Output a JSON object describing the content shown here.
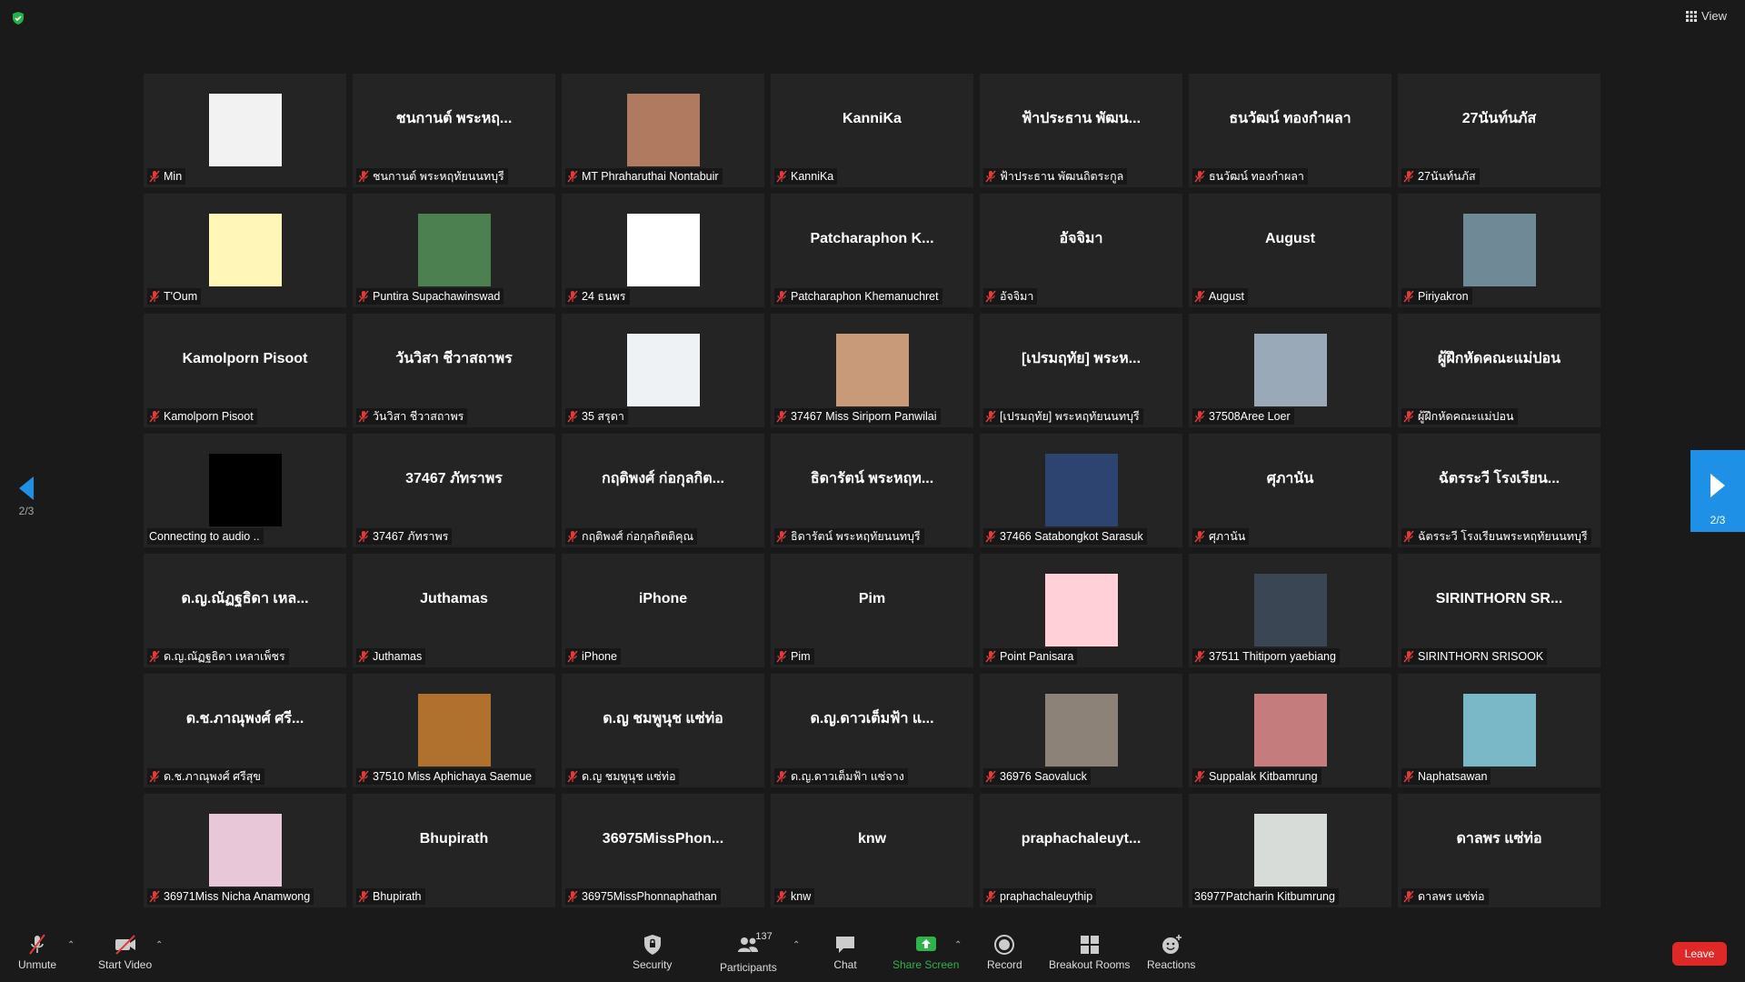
{
  "view_label": "View",
  "tiles": [
    {
      "center": "",
      "label": "Min",
      "avatar": "#f2f2f2",
      "muted": true
    },
    {
      "center": "ชนกานต์ พระหฤ...",
      "label": "ชนกานต์ พระหฤทัยนนทบุรี",
      "muted": true
    },
    {
      "center": "",
      "label": "MT Phraharuthai Nontabuir",
      "avatar": "#b07a60",
      "muted": true
    },
    {
      "center": "KanniKa",
      "label": "KanniKa",
      "muted": true
    },
    {
      "center": "ฟ้าประธาน พัฒน...",
      "label": "ฟ้าประธาน พัฒนถิตระกูล",
      "muted": true
    },
    {
      "center": "ธนวัฒน์ ทองกำผลา",
      "label": "ธนวัฒน์ ทองกำผลา",
      "muted": true
    },
    {
      "center": "27นันท์นภัส",
      "label": "27นันท์นภัส",
      "muted": true
    },
    {
      "center": "",
      "label": "T'Oum",
      "avatar": "#fff6b8",
      "muted": true
    },
    {
      "center": "",
      "label": "Puntira Supachawinswad",
      "avatar": "#4d8050",
      "muted": true
    },
    {
      "center": "",
      "label": "24 ธนพร",
      "avatar": "#ffffff",
      "muted": true
    },
    {
      "center": "Patcharaphon  K...",
      "label": "Patcharaphon Khemanuchret",
      "muted": true
    },
    {
      "center": "อัจจิมา",
      "label": "อัจจิมา",
      "muted": true
    },
    {
      "center": "August",
      "label": "August",
      "muted": true
    },
    {
      "center": "",
      "label": "Piriyakron",
      "avatar": "#6f8a96",
      "muted": true
    },
    {
      "center": "Kamolporn Pisoot",
      "label": "Kamolporn Pisoot",
      "muted": true
    },
    {
      "center": "วันวิสา ชีวาสถาพร",
      "label": "วันวิสา ชีวาสถาพร",
      "muted": true
    },
    {
      "center": "",
      "label": "35 สรุดา",
      "avatar": "#eef2f5",
      "muted": true
    },
    {
      "center": "",
      "label": "37467 Miss Siriporn Panwilai",
      "avatar": "#c99a7a",
      "muted": true
    },
    {
      "center": "[เปรมฤทัย] พระห...",
      "label": "[เปรมฤทัย] พระหฤทัยนนทบุรี",
      "muted": true
    },
    {
      "center": "",
      "label": "37508Aree Loer",
      "avatar": "#9aa9b8",
      "muted": true
    },
    {
      "center": "ผู้ฝึกหัดคณะแม่ปอน",
      "label": "ผู้ฝึกหัดคณะแม่ปอน",
      "muted": true
    },
    {
      "center": "",
      "label": "Connecting to audio ..",
      "avatar": "#000000",
      "muted": false
    },
    {
      "center": "37467 ภัทราพร",
      "label": "37467 ภัทราพร",
      "muted": true
    },
    {
      "center": "กฤติพงศ์ ก่อกุลกิต...",
      "label": "กฤติพงศ์ ก่อกุลกิตติคุณ",
      "muted": true
    },
    {
      "center": "ธิดารัตน์ พระหฤท...",
      "label": "ธิดารัตน์ พระหฤทัยนนทบุรี",
      "muted": true
    },
    {
      "center": "",
      "label": "37466 Satabongkot Sarasuk",
      "avatar": "#2d4470",
      "muted": true
    },
    {
      "center": "ศุภานัน",
      "label": "ศุภานัน",
      "muted": true
    },
    {
      "center": "ฉัตรระวี โรงเรียน...",
      "label": "ฉัตรระวี โรงเรียนพระหฤทัยนนทบุรี",
      "muted": true
    },
    {
      "center": "ด.ญ.ณัฏฐธิดา เหล...",
      "label": "ด.ญ.ณัฏฐธิดา เหลาเพ็ชร",
      "muted": true
    },
    {
      "center": "Juthamas",
      "label": "Juthamas",
      "muted": true
    },
    {
      "center": "iPhone",
      "label": "iPhone",
      "muted": true
    },
    {
      "center": "Pim",
      "label": "Pim",
      "muted": true
    },
    {
      "center": "",
      "label": "Point Panisara",
      "avatar": "#ffd0d8",
      "muted": true
    },
    {
      "center": "",
      "label": "37511 Thitiporn yaebiang",
      "avatar": "#3a4654",
      "muted": true
    },
    {
      "center": "SIRINTHORN  SR...",
      "label": "SIRINTHORN SRISOOK",
      "muted": true
    },
    {
      "center": "ด.ช.ภาณุพงศ์ ศรี...",
      "label": "ด.ช.ภาณุพงศ์ ศรีสุข",
      "muted": true
    },
    {
      "center": "",
      "label": "37510 Miss Aphichaya Saemue",
      "avatar": "#b0702e",
      "muted": true
    },
    {
      "center": "ด.ญ ชมพูนุช แซ่ท่อ",
      "label": "ด.ญ ชมพูนุช แซ่ท่อ",
      "muted": true
    },
    {
      "center": "ด.ญ.ดาวเต็มฟ้า แ...",
      "label": "ด.ญ.ดาวเต็มฟ้า แซ่จาง",
      "muted": true
    },
    {
      "center": "",
      "label": "36976 Saovaluck",
      "avatar": "#8c8278",
      "muted": true
    },
    {
      "center": "",
      "label": "Suppalak Kitbamrung",
      "avatar": "#c47c7c",
      "muted": true
    },
    {
      "center": "",
      "label": "Naphatsawan",
      "avatar": "#7ab8c8",
      "muted": true
    },
    {
      "center": "",
      "label": "36971Miss Nicha Anamwong",
      "avatar": "#e8c8d8",
      "muted": true
    },
    {
      "center": "Bhupirath",
      "label": "Bhupirath",
      "muted": true
    },
    {
      "center": "36975MissPhon...",
      "label": "36975MissPhonnaphathan",
      "muted": true
    },
    {
      "center": "knw",
      "label": "knw",
      "muted": true
    },
    {
      "center": "praphachaleuyt...",
      "label": "praphachaleuythip",
      "muted": true
    },
    {
      "center": "",
      "label": "36977Patcharin Kitbumrung",
      "avatar": "#d8dcd8",
      "muted": false
    },
    {
      "center": "ดาลพร แซ่ท่อ",
      "label": "ดาลพร แซ่ท่อ",
      "muted": true
    }
  ],
  "nav": {
    "left_page": "2/3",
    "right_page": "2/3"
  },
  "toolbar": {
    "unmute": "Unmute",
    "start_video": "Start Video",
    "security": "Security",
    "participants": "Participants",
    "participants_count": "137",
    "chat": "Chat",
    "share_screen": "Share Screen",
    "record": "Record",
    "breakout_rooms": "Breakout Rooms",
    "reactions": "Reactions",
    "leave": "Leave"
  },
  "colors": {
    "accent": "#1e90e6",
    "share": "#2fb24a",
    "leave": "#e02828",
    "muted_mic": "#e03b3b"
  }
}
